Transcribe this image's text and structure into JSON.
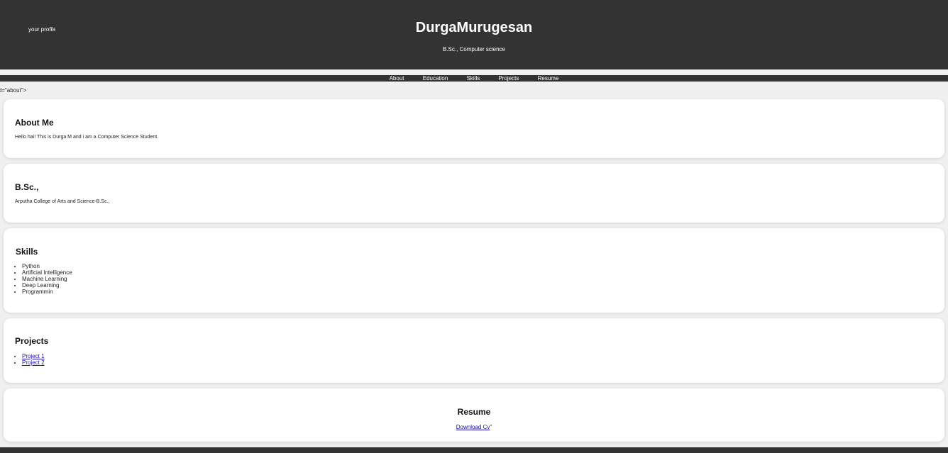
{
  "header": {
    "avatar_alt": "your profile picture",
    "name": "DurgaMurugesan",
    "subtitle": "B.Sc., Computer science"
  },
  "nav": [
    "About",
    "Education",
    "Skills",
    "Projects",
    "Resume"
  ],
  "stray_text": "id=\"about\">",
  "about": {
    "title": "About Me",
    "text": "Hello hai! This is Durga M and i am a Computer Science Student."
  },
  "education": {
    "title": "B.Sc.,",
    "text": "Arputha College of Arts and Science-B.Sc.,"
  },
  "skills": {
    "title": "Skills",
    "items": [
      "Python",
      "Artificial Intelligence",
      "Machine Learning",
      "Deep Learning",
      "Programmin"
    ]
  },
  "projects": {
    "title": "Projects",
    "items": [
      "Project 1",
      "Project 2"
    ]
  },
  "resume": {
    "title": "Resume",
    "link": "Download Cv",
    "trailing": "\""
  }
}
